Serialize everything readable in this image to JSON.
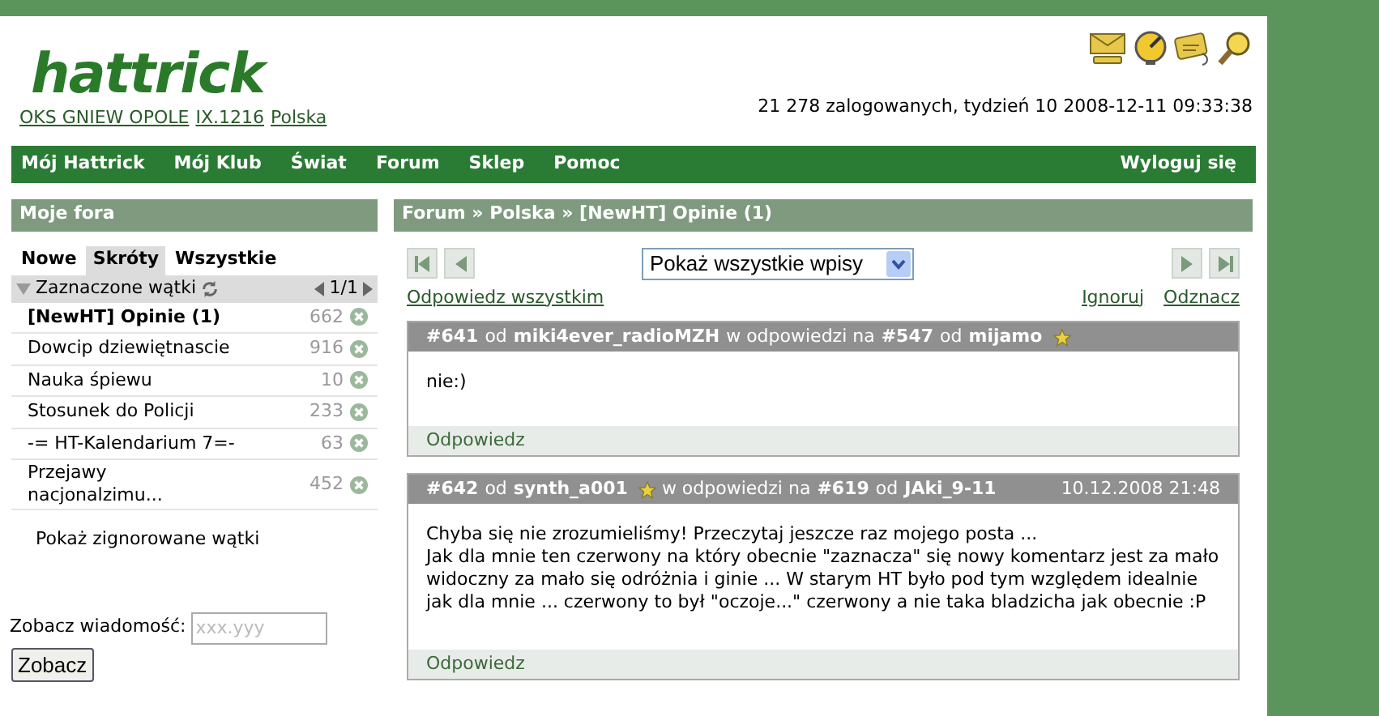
{
  "header": {
    "logo": "hattrick",
    "team_links": [
      "OKS GNIEW OPOLE",
      "IX.1216",
      "Polska"
    ],
    "status": "21 278 zalogowanych, tydzień 10 2008-12-11 09:33:38"
  },
  "nav": {
    "items": [
      "Mój Hattrick",
      "Mój Klub",
      "Świat",
      "Forum",
      "Sklep",
      "Pomoc"
    ],
    "logout": "Wyloguj się"
  },
  "sidebar": {
    "title": "Moje fora",
    "tabs": [
      {
        "label": "Nowe",
        "selected": false
      },
      {
        "label": "Skróty",
        "selected": true
      },
      {
        "label": "Wszystkie",
        "selected": false
      }
    ],
    "section": {
      "label": "Zaznaczone wątki",
      "expanded": true,
      "pager": "1/1"
    },
    "threads": [
      {
        "title": "[NewHT] Opinie (1)",
        "count": "662",
        "unread": true
      },
      {
        "title": "Dowcip dziewiętnascie",
        "count": "916",
        "unread": false
      },
      {
        "title": "Nauka śpiewu",
        "count": "10",
        "unread": false
      },
      {
        "title": "Stosunek do Policji",
        "count": "233",
        "unread": false
      },
      {
        "title": "-= HT-Kalendarium 7=-",
        "count": "63",
        "unread": false
      },
      {
        "title": "Przejawy nacjonalzimu...",
        "count": "452",
        "unread": false
      }
    ],
    "show_ignored": "Pokaż zignorowane wątki",
    "goto": {
      "label": "Zobacz wiadomość:",
      "placeholder": "xxx.yyy",
      "button": "Zobacz"
    }
  },
  "main": {
    "breadcrumb": "Forum » Polska » [NewHT] Opinie (1)",
    "filter": "Pokaż wszystkie wpisy",
    "reply_all": "Odpowiedz wszystkim",
    "actions": [
      "Ignoruj",
      "Odznacz"
    ],
    "posts": [
      {
        "header": [
          {
            "kind": "bold",
            "text": "#641"
          },
          {
            "kind": "plain",
            "text": "od"
          },
          {
            "kind": "bold",
            "text": "miki4ever_radioMZH"
          },
          {
            "kind": "plain",
            "text": "w odpowiedzi na"
          },
          {
            "kind": "bold",
            "text": "#547"
          },
          {
            "kind": "plain",
            "text": "od"
          },
          {
            "kind": "bold",
            "text": "mijamo"
          },
          {
            "kind": "star"
          }
        ],
        "body": [
          "nie:)"
        ],
        "reply": "Odpowiedz"
      },
      {
        "header": [
          {
            "kind": "bold",
            "text": "#642"
          },
          {
            "kind": "plain",
            "text": "od"
          },
          {
            "kind": "bold",
            "text": "synth_a001"
          },
          {
            "kind": "star"
          },
          {
            "kind": "plain",
            "text": "w odpowiedzi na"
          },
          {
            "kind": "bold",
            "text": "#619"
          },
          {
            "kind": "plain",
            "text": "od"
          },
          {
            "kind": "bold",
            "text": "JAki_9-11"
          }
        ],
        "date": "10.12.2008 21:48",
        "body": [
          "Chyba się nie zrozumieliśmy! Przeczytaj jeszcze raz mojego posta ...",
          "Jak dla mnie ten czerwony na który obecnie \"zaznacza\" się nowy komentarz jest za mało widoczny za mało się odróżnia i ginie ... W starym HT było pod tym względem idealnie jak dla mnie ... czerwony to był \"oczoje...\" czerwony a nie taka bladzicha jak obecnie :P"
        ],
        "reply": "Odpowiedz"
      }
    ]
  }
}
